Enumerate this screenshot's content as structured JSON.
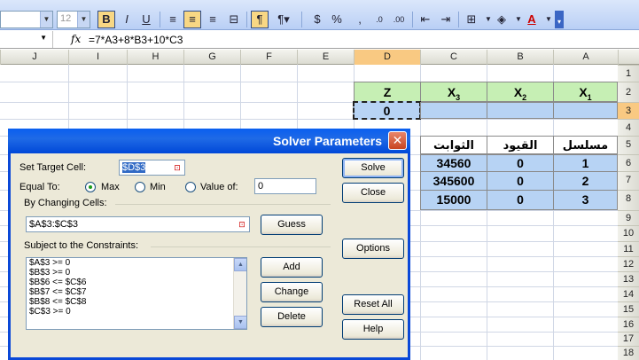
{
  "toolbar": {
    "font_size": "12",
    "bold": "B",
    "italic": "I",
    "underline": "U",
    "percent": "%"
  },
  "formula_bar": {
    "fx": "fx",
    "formula": "=7*A3+8*B3+10*C3"
  },
  "columns": [
    "J",
    "I",
    "H",
    "G",
    "F",
    "E",
    "D",
    "C",
    "B",
    "A"
  ],
  "rows": [
    "1",
    "2",
    "3",
    "4",
    "5",
    "6",
    "7",
    "8",
    "9",
    "10",
    "11",
    "12",
    "13",
    "14",
    "15",
    "16",
    "17",
    "18"
  ],
  "sheet": {
    "z_header": "Z",
    "x3": "X",
    "x3_sub": "3",
    "x2": "X",
    "x2_sub": "2",
    "x1": "X",
    "x1_sub": "1",
    "z_value": "0",
    "constants_header": "الثوابت",
    "constraints_header": "القيود",
    "serial_header": "مسلسل",
    "data_rows": [
      {
        "constant": "34560",
        "constraint": "0",
        "serial": "1"
      },
      {
        "constant": "345600",
        "constraint": "0",
        "serial": "2"
      },
      {
        "constant": "15000",
        "constraint": "0",
        "serial": "3"
      }
    ]
  },
  "dialog": {
    "title": "Solver Parameters",
    "close": "✕",
    "set_target_label": "Set Target Cell:",
    "target_value": "$D$3",
    "equal_to_label": "Equal To:",
    "max_label": "Max",
    "min_label": "Min",
    "value_of_label": "Value of:",
    "value_of_input": "0",
    "by_changing_label": "By Changing Cells:",
    "changing_value": "$A$3:$C$3",
    "guess": "Guess",
    "subject_label": "Subject to the Constraints:",
    "constraints": [
      "$A$3 >= 0",
      "$B$3 >= 0",
      "$B$6 <= $C$6",
      "$B$7 <= $C$7",
      "$B$8 <= $C$8",
      "$C$3 >= 0"
    ],
    "add": "Add",
    "change": "Change",
    "delete": "Delete",
    "solve": "Solve",
    "close_btn": "Close",
    "options": "Options",
    "reset_all": "Reset All",
    "help": "Help"
  }
}
